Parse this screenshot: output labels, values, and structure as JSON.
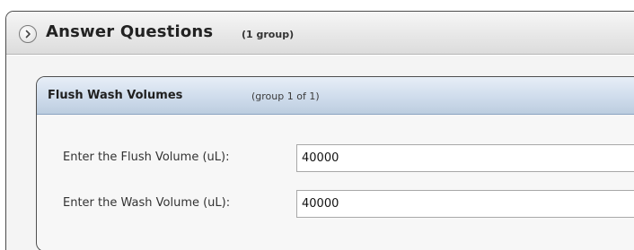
{
  "panel": {
    "title": "Answer Questions",
    "count": "(1 group)",
    "expand_icon": "chevron-right-circle-icon"
  },
  "group": {
    "title": "Flush Wash Volumes",
    "count": "(group 1 of 1)",
    "fields": [
      {
        "label": "Enter the Flush Volume (uL):",
        "value": "40000"
      },
      {
        "label": "Enter the Wash Volume (uL):",
        "value": "40000"
      }
    ]
  }
}
